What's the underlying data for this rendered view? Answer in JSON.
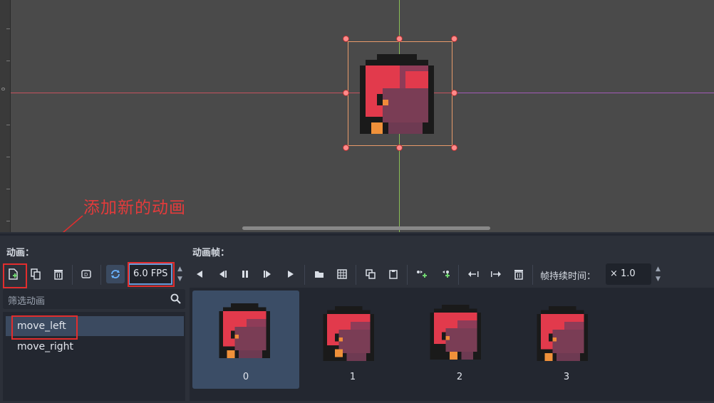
{
  "viewport": {
    "ruler_zero": "0",
    "annotation": "添加新的动画"
  },
  "animations_panel": {
    "label": "动画：",
    "filter_placeholder": "筛选动画",
    "items": [
      {
        "label": "move_left",
        "selected": true
      },
      {
        "label": "move_right",
        "selected": false
      }
    ],
    "fps": "6.0 FPS"
  },
  "frames_panel": {
    "label": "动画帧：",
    "duration_label": "帧持续时间：",
    "duration_value": "× 1.0",
    "frames": [
      {
        "index": "0",
        "selected": true
      },
      {
        "index": "1",
        "selected": false
      },
      {
        "index": "2",
        "selected": false
      },
      {
        "index": "3",
        "selected": false
      }
    ]
  },
  "colors": {
    "accent": "#6b9ad8",
    "annotation_red": "#e22d2d",
    "selected_bg": "#3b4a60"
  }
}
